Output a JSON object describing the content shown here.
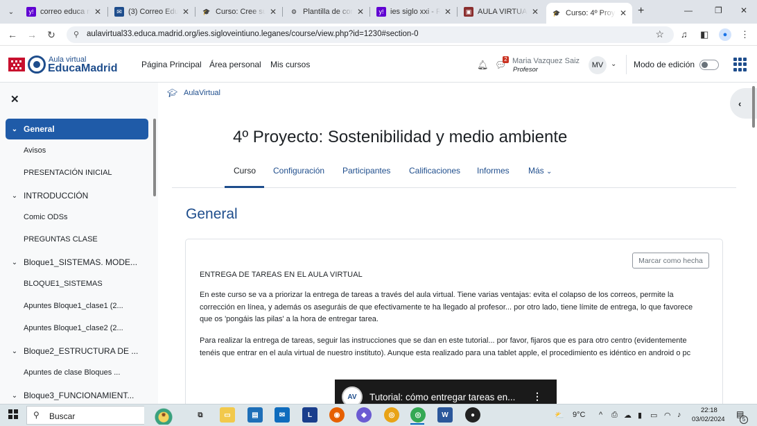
{
  "browser": {
    "tabs": [
      {
        "title": "correo educa m",
        "icon": "yahoo-icon"
      },
      {
        "title": "(3) Correo Educ",
        "icon": "mail-icon"
      },
      {
        "title": "Curso: Cree su p",
        "icon": "moodle-cap-icon"
      },
      {
        "title": "Plantilla de cont",
        "icon": "template-icon"
      },
      {
        "title": "ies siglo xxi - Re",
        "icon": "yahoo-icon"
      },
      {
        "title": "AULA VIRTUAL",
        "icon": "aula-virtual-icon"
      },
      {
        "title": "Curso: 4º Proye",
        "icon": "moodle-cap-icon",
        "active": true
      }
    ],
    "url": "aulavirtual33.educa.madrid.org/ies.sigloveintiuno.leganes/course/view.php?id=1230#section-0"
  },
  "navbar": {
    "logo_small": "Aula virtual",
    "logo_big": "EducaMadrid",
    "links": [
      "Página Principal",
      "Área personal",
      "Mis cursos"
    ],
    "message_count": "2",
    "user_name": "Maria Vazquez Saiz",
    "user_role": "Profesor",
    "user_initials": "MV",
    "edit_mode_label": "Modo de edición"
  },
  "course_index": {
    "items": [
      {
        "type": "section",
        "label": "General",
        "active": true
      },
      {
        "type": "item",
        "label": "Avisos"
      },
      {
        "type": "item",
        "label": "PRESENTACIÓN INICIAL"
      },
      {
        "type": "section",
        "label": "INTRODUCCIÓN"
      },
      {
        "type": "item",
        "label": "Comic ODSs"
      },
      {
        "type": "item",
        "label": "PREGUNTAS CLASE"
      },
      {
        "type": "section",
        "label": "Bloque1_SISTEMAS. MODE..."
      },
      {
        "type": "item",
        "label": "BLOQUE1_SISTEMAS"
      },
      {
        "type": "item",
        "label": "Apuntes Bloque1_clase1 (2..."
      },
      {
        "type": "item",
        "label": "Apuntes Bloque1_clase2 (2..."
      },
      {
        "type": "section",
        "label": "Bloque2_ESTRUCTURA DE ..."
      },
      {
        "type": "item",
        "label": "Apuntes de clase Bloques ..."
      },
      {
        "type": "section",
        "label": "Bloque3_FUNCIONAMIENT..."
      }
    ]
  },
  "main": {
    "breadcrumb": "AulaVirtual",
    "title": "4º Proyecto: Sostenibilidad y medio ambiente",
    "secondary_nav": [
      "Curso",
      "Configuración",
      "Participantes",
      "Calificaciones",
      "Informes",
      "Más"
    ],
    "section_title": "General",
    "mark_done": "Marcar como hecha",
    "label_heading": "ENTREGA DE TAREAS EN EL AULA VIRTUAL",
    "paragraph1": "En este curso se va a priorizar la entrega de tareas a través del aula virtual. Tiene varias ventajas: evita el colapso de los correos, permite la corrección en línea, y además os aseguráis de que efectivamente te ha llegado al profesor... por otro lado, tiene límite de entrega, lo que favorece que os 'pongáis las pilas' a la hora de entregar tarea.",
    "paragraph2": "Para realizar la entrega de tareas, seguir las instrucciones que se dan en este tutorial... por favor, fijaros que es para otro centro (evidentemente tenéis que entrar en el aula virtual de nuestro instituto). Aunque esta realizado para una tablet apple, el procedimiento es idéntico en android o pc",
    "video_title": "Tutorial: cómo entregar tareas en..."
  },
  "taskbar": {
    "search_placeholder": "Buscar",
    "weather": "9°C",
    "time": "22:18",
    "date": "03/02/2024",
    "notifications": "5"
  }
}
